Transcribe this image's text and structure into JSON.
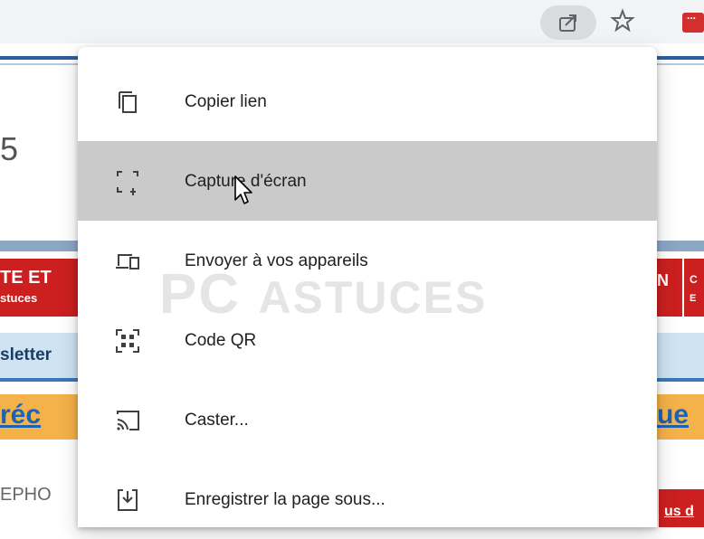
{
  "page": {
    "big_number": "5",
    "red_tab_left_line1": "TE ET",
    "red_tab_left_line2": "stuces",
    "red_tab_right_line1": "N",
    "right_box_line1": "C",
    "right_box_line2": "E",
    "newsletter_fragment": "sletter",
    "orange_left_fragment": "réc",
    "orange_right_fragment": "ue",
    "ephon_fragment": "EPHO",
    "red_bottom_fragment": "us d"
  },
  "watermark": {
    "part1": "PC",
    "part2": "ASTUCES"
  },
  "menu": {
    "items": [
      {
        "label": "Copier lien",
        "icon": "copy-icon",
        "hovered": false
      },
      {
        "label": "Capture d'écran",
        "icon": "screenshot-icon",
        "hovered": true
      },
      {
        "label": "Envoyer à vos appareils",
        "icon": "devices-icon",
        "hovered": false
      },
      {
        "label": "Code QR",
        "icon": "qr-code-icon",
        "hovered": false
      },
      {
        "label": "Caster...",
        "icon": "cast-icon",
        "hovered": false
      },
      {
        "label": "Enregistrer la page sous...",
        "icon": "save-page-icon",
        "hovered": false
      }
    ]
  }
}
